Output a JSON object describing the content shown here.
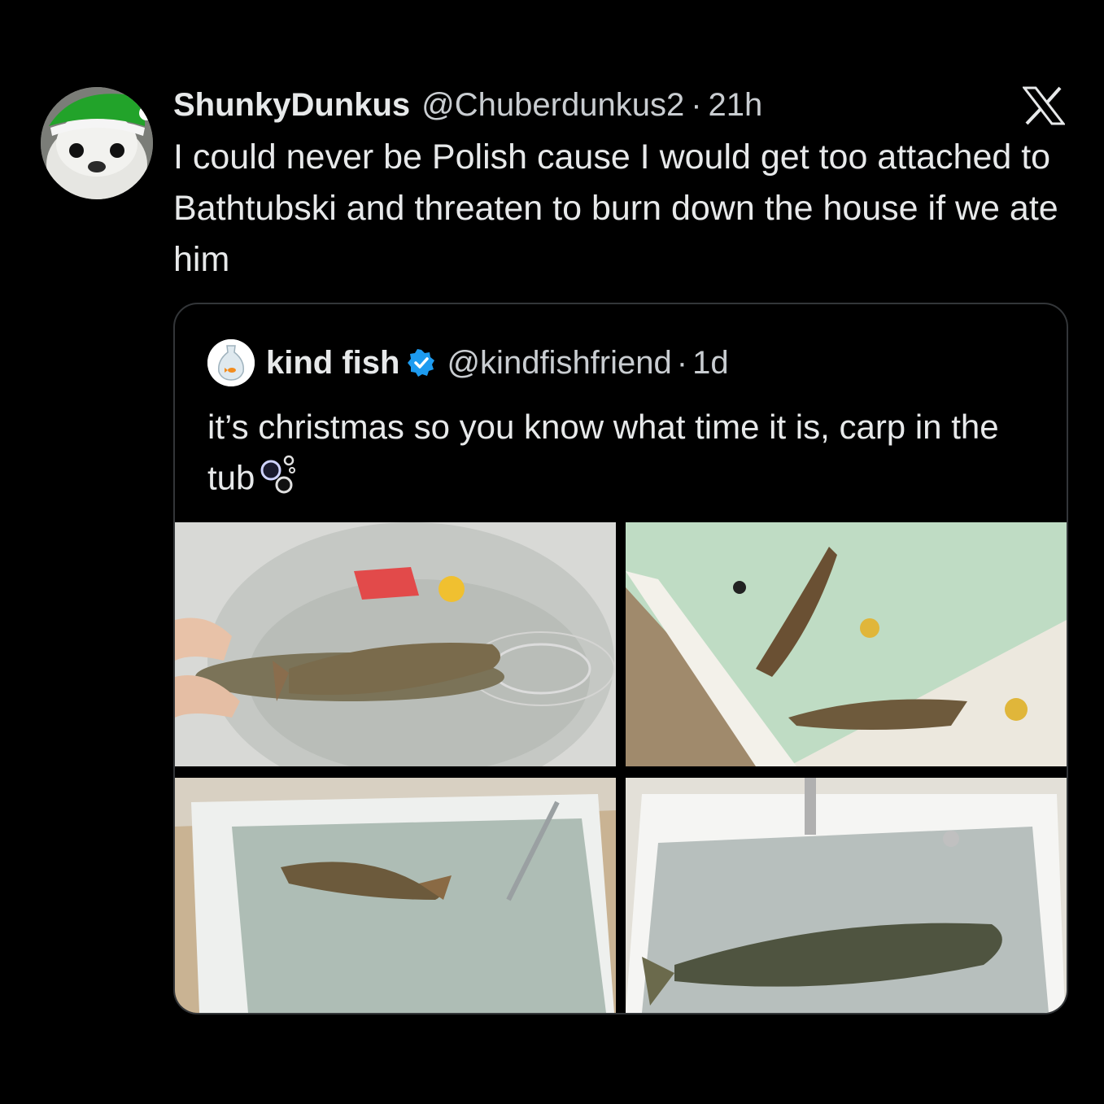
{
  "tweet": {
    "display_name": "ShunkyDunkus",
    "handle": "@Chuberdunkus2",
    "separator": "·",
    "time": "21h",
    "text": "I could never be Polish cause I would get too attached to Bathtubski and threaten to burn down the house if we ate him",
    "avatar_icon": "seal-with-green-santa-hat-avatar",
    "platform_logo": "x-logo-icon"
  },
  "quote": {
    "display_name": "kind fish",
    "handle": "@kindfishfriend",
    "separator": "·",
    "time": "1d",
    "verified_color": "#1d9bf0",
    "text": "it’s christmas so you know what time it is, carp in the tub",
    "text_emoji": "bubbles-icon",
    "avatar_icon": "goldfish-in-bag-avatar",
    "media": [
      {
        "name": "carp-in-tub-photo-1",
        "description_icon": "photo"
      },
      {
        "name": "carp-in-tub-photo-2",
        "description_icon": "photo"
      },
      {
        "name": "carp-in-tub-photo-3",
        "description_icon": "photo"
      },
      {
        "name": "carp-in-tub-photo-4",
        "description_icon": "photo"
      }
    ]
  },
  "colors": {
    "background": "#000000",
    "text_primary": "#e7e9ea",
    "text_secondary": "#c9cdd1",
    "card_border": "#333639"
  }
}
